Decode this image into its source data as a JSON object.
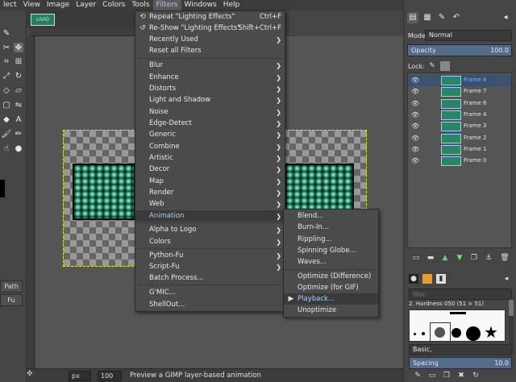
{
  "menubar": {
    "items": [
      "lect",
      "View",
      "Image",
      "Layer",
      "Colors",
      "Tools",
      "Filters",
      "Windows",
      "Help"
    ],
    "active_index": 6
  },
  "toolbox": {
    "path_button": "Path",
    "fu_button": "Fu"
  },
  "image_window": {
    "tab_thumb_text": "LIVIO"
  },
  "filters_menu": {
    "items": [
      {
        "label": "Repeat \"Lighting Effects\"",
        "accel": "Ctrl+F",
        "icon": "repeat-icon"
      },
      {
        "label": "Re-Show \"Lighting Effects\"",
        "accel": "Shift+Ctrl+F",
        "icon": "reshow-icon"
      },
      {
        "label": "Recently Used",
        "submenu": true
      },
      {
        "label": "Reset all Filters"
      },
      {
        "label": "Blur",
        "submenu": true
      },
      {
        "label": "Enhance",
        "submenu": true
      },
      {
        "label": "Distorts",
        "submenu": true
      },
      {
        "label": "Light and Shadow",
        "submenu": true
      },
      {
        "label": "Noise",
        "submenu": true
      },
      {
        "label": "Edge-Detect",
        "submenu": true
      },
      {
        "label": "Generic",
        "submenu": true
      },
      {
        "label": "Combine",
        "submenu": true
      },
      {
        "label": "Artistic",
        "submenu": true
      },
      {
        "label": "Decor",
        "submenu": true
      },
      {
        "label": "Map",
        "submenu": true
      },
      {
        "label": "Render",
        "submenu": true
      },
      {
        "label": "Web",
        "submenu": true
      },
      {
        "label": "Animation",
        "submenu": true,
        "highlighted": true
      },
      {
        "label": "Alpha to Logo",
        "submenu": true
      },
      {
        "label": "Colors",
        "submenu": true
      },
      {
        "label": "Python-Fu",
        "submenu": true
      },
      {
        "label": "Script-Fu",
        "submenu": true
      },
      {
        "label": "Batch Process..."
      },
      {
        "label": "G'MIC..."
      },
      {
        "label": "ShellOut..."
      }
    ]
  },
  "animation_menu": {
    "items": [
      {
        "label": "Blend..."
      },
      {
        "label": "Burn-In..."
      },
      {
        "label": "Rippling..."
      },
      {
        "label": "Spinning Globe..."
      },
      {
        "label": "Waves..."
      },
      {
        "label": "Optimize (Difference)"
      },
      {
        "label": "Optimize (for GIF)"
      },
      {
        "label": "Playback...",
        "highlighted": true
      },
      {
        "label": "Unoptimize"
      }
    ]
  },
  "statusbar": {
    "unit": "px",
    "zoom": "100 %",
    "message": "Preview a GIMP layer-based animation"
  },
  "layers_panel": {
    "mode_label": "Mode:",
    "mode_value": "Normal",
    "opacity_label": "Opacity",
    "opacity_value": "100.0",
    "lock_label": "Lock:",
    "layers": [
      "Frame 8",
      "Frame 7",
      "Frame 6",
      "Frame 4",
      "Frame 3",
      "Frame 2",
      "Frame 1",
      "Frame 0"
    ],
    "selected_layer_index": 0
  },
  "brushes_panel": {
    "filter_placeholder": "filter",
    "brush_name": "2. Hardness 050 (51 × 51)",
    "preset": "Basic,",
    "spacing_label": "Spacing",
    "spacing_value": "10.0"
  },
  "colors": {
    "menu_bg": "#4b4b4b",
    "highlight": "#3a3a3a",
    "accent_text": "#a8d0ff",
    "selected_layer": "#3b5170",
    "canvas_object": "#2c8f6c"
  }
}
